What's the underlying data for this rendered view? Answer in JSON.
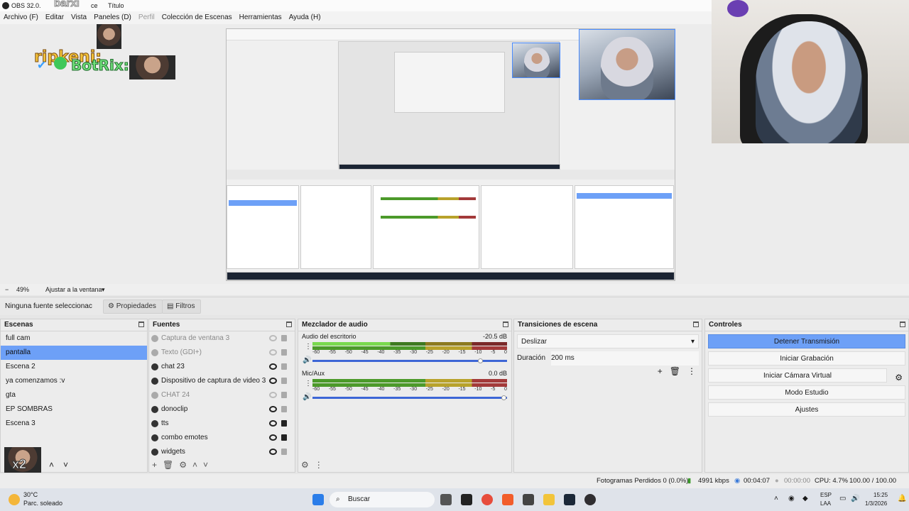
{
  "window": {
    "title_left": "OBS 32.0.",
    "title_mid": "ce",
    "title_right": "Título"
  },
  "menu": [
    "Archivo (F)",
    "Editar",
    "Vista",
    "Paneles (D)",
    "Perfil",
    "Colección de Escenas",
    "Herramientas",
    "Ayuda (H)"
  ],
  "overlays": {
    "ripkeni": "ripkeni:",
    "botrix": "BotRix:",
    "barxi": "barxi"
  },
  "zoom": {
    "percent": "49%",
    "fit": "Ajustar a la ventana"
  },
  "propbar": {
    "no_source": "Ninguna fuente seleccionac",
    "properties": "Propiedades",
    "filters": "Filtros"
  },
  "scenes": {
    "title": "Escenas",
    "items": [
      "full cam",
      "pantalla",
      "Escena 2",
      "ya comenzamos :v",
      "gta",
      "EP SOMBRAS",
      "Escena 3"
    ],
    "selected_index": 1
  },
  "sources": {
    "title": "Fuentes",
    "items": [
      {
        "label": "Captura de ventana 3",
        "visible": false,
        "locked": false
      },
      {
        "label": "Texto (GDI+)",
        "visible": false,
        "locked": false
      },
      {
        "label": "chat 23",
        "visible": true,
        "locked": false
      },
      {
        "label": "Dispositivo de captura de video 3",
        "visible": true,
        "locked": false
      },
      {
        "label": "CHAT 24",
        "visible": false,
        "locked": false
      },
      {
        "label": "donoclip",
        "visible": true,
        "locked": false
      },
      {
        "label": "tts",
        "visible": true,
        "locked": true
      },
      {
        "label": "combo emotes",
        "visible": true,
        "locked": true
      },
      {
        "label": "widgets",
        "visible": true,
        "locked": false
      }
    ]
  },
  "mixer": {
    "title": "Mezclador de audio",
    "tracks": [
      {
        "name": "Audio del escritorio",
        "db": "-20.5 dB",
        "volume": 0.9
      },
      {
        "name": "Mic/Aux",
        "db": "0.0 dB",
        "volume": 1.0
      }
    ],
    "scale": [
      "-60",
      "-55",
      "-50",
      "-45",
      "-40",
      "-35",
      "-30",
      "-25",
      "-20",
      "-15",
      "-10",
      "-5",
      "0"
    ]
  },
  "transitions": {
    "title": "Transiciones de escena",
    "current": "Deslizar",
    "duration_label": "Duración",
    "duration_value": "200 ms"
  },
  "controls": {
    "title": "Controles",
    "buttons": [
      "Detener Transmisión",
      "Iniciar Grabación",
      "Iniciar Cámara Virtual",
      "Modo Estudio",
      "Ajustes"
    ]
  },
  "status": {
    "dropped": "Fotogramas Perdidos 0 (0.0%)",
    "bitrate": "4991 kbps",
    "stream_time": "00:04:07",
    "rec_time": "00:00:00",
    "cpu": "CPU: 4.7%",
    "fps": "100.00 / 100.00 FPS"
  },
  "taskbar": {
    "weather_temp": "30°C",
    "weather_desc": "Parc. soleado",
    "search": "Buscar",
    "lang_top": "ESP",
    "lang_bottom": "LAA",
    "time": "15:25",
    "date": "1/3/2026",
    "badge": "x2"
  },
  "colors": {
    "accent": "#6da0f7",
    "meter_green": "#4c9a2a",
    "meter_yellow": "#b8a22b",
    "meter_red": "#a33a3a"
  }
}
